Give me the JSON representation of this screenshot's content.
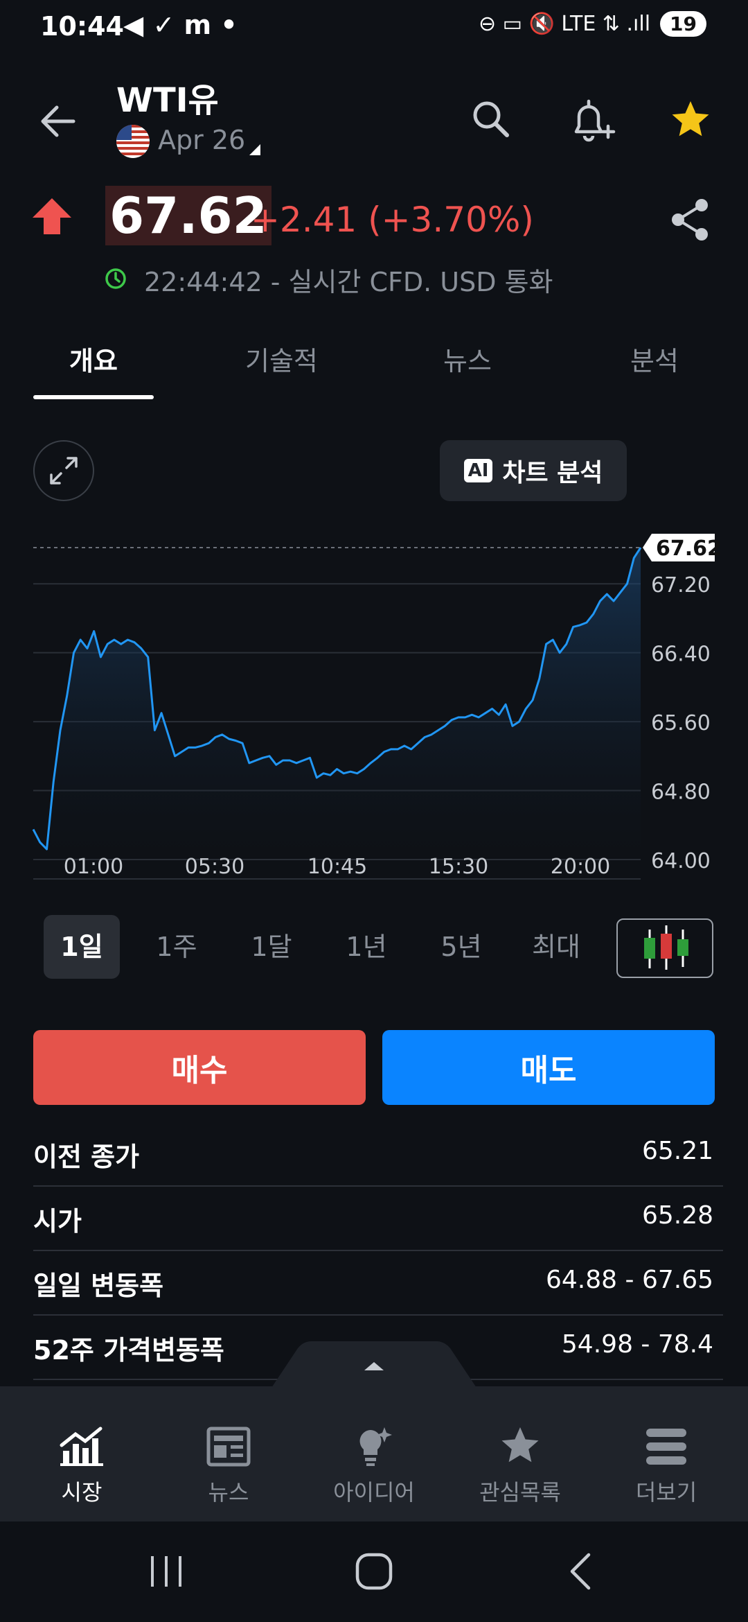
{
  "status_bar": {
    "time": "10:44",
    "left_icons": "◀ ✓ m •",
    "right_icons": "⊖ ▭ 🔇 LTE ⇅ .ıll",
    "battery": "19"
  },
  "header": {
    "title": "WTI유",
    "date": "Apr 26"
  },
  "quote": {
    "price": "67.62",
    "change": "+2.41 (+3.70%)",
    "timestamp": "22:44:42 - 실시간 CFD. USD 통화"
  },
  "tabs": [
    {
      "label": "개요",
      "active": true
    },
    {
      "label": "기술적",
      "active": false
    },
    {
      "label": "뉴스",
      "active": false
    },
    {
      "label": "분석",
      "active": false
    }
  ],
  "ai_button": {
    "badge": "AI",
    "label": "차트 분석"
  },
  "chart_data": {
    "type": "area",
    "x_ticks": [
      "01:00",
      "05:30",
      "10:45",
      "15:30",
      "20:00"
    ],
    "y_ticks": [
      "67.20",
      "66.40",
      "65.60",
      "64.80",
      "64.00"
    ],
    "ylim": [
      64.0,
      67.62
    ],
    "last_value_label": "67.62",
    "grid": true,
    "values": [
      64.35,
      64.2,
      64.12,
      64.9,
      65.5,
      65.9,
      66.4,
      66.55,
      66.45,
      66.65,
      66.35,
      66.5,
      66.55,
      66.5,
      66.55,
      66.52,
      66.45,
      66.35,
      65.5,
      65.7,
      65.45,
      65.2,
      65.25,
      65.3,
      65.3,
      65.32,
      65.35,
      65.42,
      65.45,
      65.4,
      65.38,
      65.35,
      65.12,
      65.15,
      65.18,
      65.2,
      65.1,
      65.15,
      65.15,
      65.12,
      65.15,
      65.18,
      64.95,
      65.0,
      64.98,
      65.05,
      65.0,
      65.02,
      65.0,
      65.05,
      65.12,
      65.18,
      65.25,
      65.28,
      65.28,
      65.32,
      65.28,
      65.35,
      65.42,
      65.45,
      65.5,
      65.55,
      65.62,
      65.65,
      65.65,
      65.68,
      65.65,
      65.7,
      65.75,
      65.68,
      65.8,
      65.55,
      65.6,
      65.75,
      65.85,
      66.1,
      66.5,
      66.55,
      66.4,
      66.5,
      66.7,
      66.72,
      66.75,
      66.85,
      67.0,
      67.08,
      67.0,
      67.1,
      67.2,
      67.5,
      67.62
    ],
    "line_color": "#2196f3"
  },
  "periods": [
    {
      "label": "1일",
      "active": true
    },
    {
      "label": "1주",
      "active": false
    },
    {
      "label": "1달",
      "active": false
    },
    {
      "label": "1년",
      "active": false
    },
    {
      "label": "5년",
      "active": false
    },
    {
      "label": "최대",
      "active": false
    }
  ],
  "actions": {
    "buy": "매수",
    "sell": "매도"
  },
  "stats": [
    {
      "label": "이전 종가",
      "value": "65.21"
    },
    {
      "label": "시가",
      "value": "65.28"
    },
    {
      "label": "일일 변동폭",
      "value": "64.88 - 67.65"
    },
    {
      "label": "52주 가격변동폭",
      "value": "54.98 - 78.4"
    }
  ],
  "bottom_nav": [
    {
      "label": "시장",
      "icon": "market-chart-icon",
      "active": true
    },
    {
      "label": "뉴스",
      "icon": "newspaper-icon",
      "active": false
    },
    {
      "label": "아이디어",
      "icon": "lightbulb-icon",
      "active": false
    },
    {
      "label": "관심목록",
      "icon": "star-icon",
      "active": false
    },
    {
      "label": "더보기",
      "icon": "menu-icon",
      "active": false
    }
  ],
  "colors": {
    "background": "#0e1116",
    "up": "#ef5350",
    "buy": "#e5534b",
    "sell": "#0a84ff",
    "star": "#f5c518"
  }
}
